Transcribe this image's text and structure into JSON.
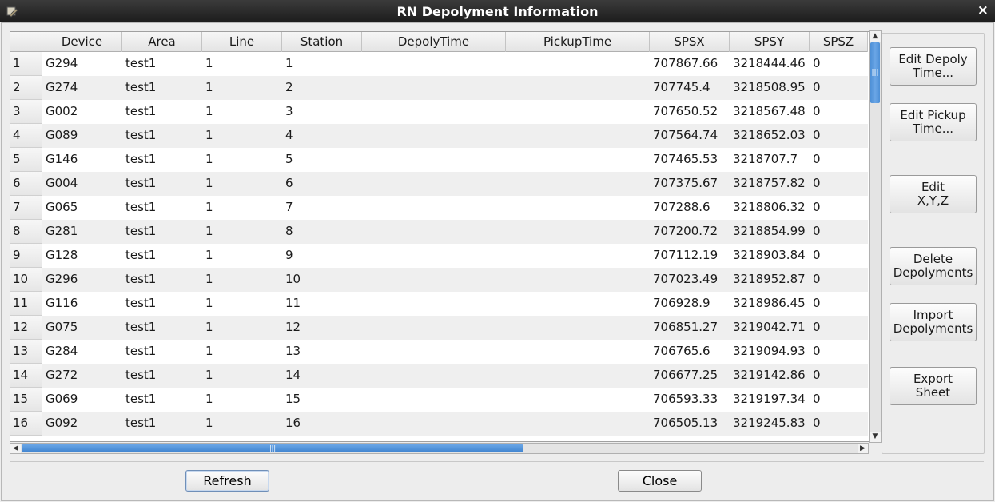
{
  "window": {
    "title": "RN Depolyment Information",
    "close_glyph": "×"
  },
  "table": {
    "columns": [
      "Device",
      "Area",
      "Line",
      "Station",
      "DepolyTime",
      "PickupTime",
      "SPSX",
      "SPSY",
      "SPSZ"
    ],
    "rows": [
      [
        "1",
        "G294",
        "test1",
        "1",
        "1",
        "",
        "",
        "707867.66",
        "3218444.46",
        "0"
      ],
      [
        "2",
        "G274",
        "test1",
        "1",
        "2",
        "",
        "",
        "707745.4",
        "3218508.95",
        "0"
      ],
      [
        "3",
        "G002",
        "test1",
        "1",
        "3",
        "",
        "",
        "707650.52",
        "3218567.48",
        "0"
      ],
      [
        "4",
        "G089",
        "test1",
        "1",
        "4",
        "",
        "",
        "707564.74",
        "3218652.03",
        "0"
      ],
      [
        "5",
        "G146",
        "test1",
        "1",
        "5",
        "",
        "",
        "707465.53",
        "3218707.7",
        "0"
      ],
      [
        "6",
        "G004",
        "test1",
        "1",
        "6",
        "",
        "",
        "707375.67",
        "3218757.82",
        "0"
      ],
      [
        "7",
        "G065",
        "test1",
        "1",
        "7",
        "",
        "",
        "707288.6",
        "3218806.32",
        "0"
      ],
      [
        "8",
        "G281",
        "test1",
        "1",
        "8",
        "",
        "",
        "707200.72",
        "3218854.99",
        "0"
      ],
      [
        "9",
        "G128",
        "test1",
        "1",
        "9",
        "",
        "",
        "707112.19",
        "3218903.84",
        "0"
      ],
      [
        "10",
        "G296",
        "test1",
        "1",
        "10",
        "",
        "",
        "707023.49",
        "3218952.87",
        "0"
      ],
      [
        "11",
        "G116",
        "test1",
        "1",
        "11",
        "",
        "",
        "706928.9",
        "3218986.45",
        "0"
      ],
      [
        "12",
        "G075",
        "test1",
        "1",
        "12",
        "",
        "",
        "706851.27",
        "3219042.71",
        "0"
      ],
      [
        "13",
        "G284",
        "test1",
        "1",
        "13",
        "",
        "",
        "706765.6",
        "3219094.93",
        "0"
      ],
      [
        "14",
        "G272",
        "test1",
        "1",
        "14",
        "",
        "",
        "706677.25",
        "3219142.86",
        "0"
      ],
      [
        "15",
        "G069",
        "test1",
        "1",
        "15",
        "",
        "",
        "706593.33",
        "3219197.34",
        "0"
      ],
      [
        "16",
        "G092",
        "test1",
        "1",
        "16",
        "",
        "",
        "706505.13",
        "3219245.83",
        "0"
      ]
    ]
  },
  "side_buttons": {
    "edit_deploy": "Edit Depoly\nTime...",
    "edit_pickup": "Edit Pickup\nTime...",
    "edit_xyz": "Edit\nX,Y,Z",
    "delete": "Delete\nDepolyments",
    "import": "Import\nDepolyments",
    "export": "Export\nSheet"
  },
  "bottom_buttons": {
    "refresh": "Refresh",
    "close": "Close"
  },
  "scroll": {
    "thumb_glyph": "|||",
    "up": "▲",
    "down": "▼",
    "left": "◀",
    "right": "▶"
  }
}
